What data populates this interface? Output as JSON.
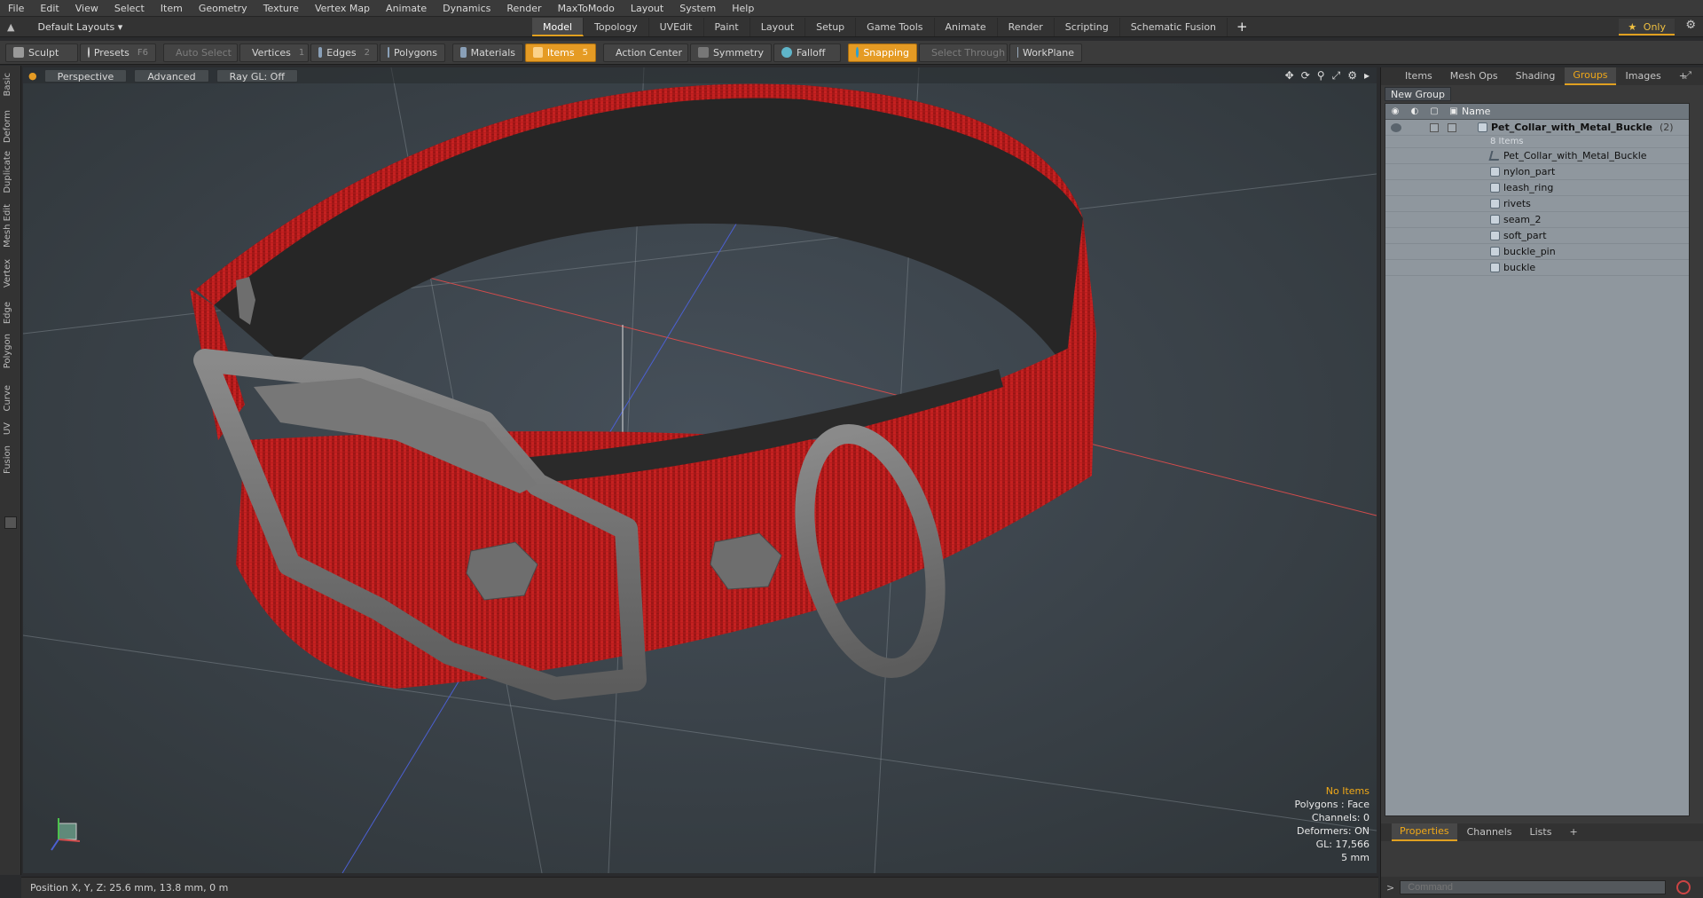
{
  "menu": [
    "File",
    "Edit",
    "View",
    "Select",
    "Item",
    "Geometry",
    "Texture",
    "Vertex Map",
    "Animate",
    "Dynamics",
    "Render",
    "MaxToModo",
    "Layout",
    "System",
    "Help"
  ],
  "layout_selector": "Default Layouts ▾",
  "top_tabs": [
    {
      "label": "Model",
      "active": true
    },
    {
      "label": "Topology",
      "active": false
    },
    {
      "label": "UVEdit",
      "active": false
    },
    {
      "label": "Paint",
      "active": false
    },
    {
      "label": "Layout",
      "active": false
    },
    {
      "label": "Setup",
      "active": false
    },
    {
      "label": "Game Tools",
      "active": false
    },
    {
      "label": "Animate",
      "active": false
    },
    {
      "label": "Render",
      "active": false
    },
    {
      "label": "Scripting",
      "active": false
    },
    {
      "label": "Schematic Fusion",
      "active": false
    }
  ],
  "add_tab": "+",
  "only_label": "Only",
  "toolbar": {
    "sculpt": "Sculpt",
    "presets": "Presets",
    "presets_key": "F6",
    "auto_select": "Auto Select",
    "vertices": "Vertices",
    "vertices_key": "1",
    "edges": "Edges",
    "edges_key": "2",
    "polygons": "Polygons",
    "materials": "Materials",
    "items": "Items",
    "items_key": "5",
    "action_center": "Action Center",
    "symmetry": "Symmetry",
    "falloff": "Falloff",
    "snapping": "Snapping",
    "select_through": "Select Through",
    "workplane": "WorkPlane"
  },
  "left_tabs": [
    "Basic",
    "Deform",
    "Duplicate",
    "Mesh Edit",
    "Vertex",
    "Edge",
    "Polygon",
    "Curve",
    "UV",
    "Fusion"
  ],
  "viewport": {
    "view": "Perspective",
    "shading": "Advanced",
    "raygl": "Ray GL: Off",
    "stats": {
      "selection": "No Items",
      "polygons": "Polygons : Face",
      "channels": "Channels: 0",
      "deformers": "Deformers: ON",
      "gl": "GL: 17,566",
      "scale": "5 mm"
    }
  },
  "status_bar": "Position X, Y, Z:   25.6 mm, 13.8 mm, 0 m",
  "right_panel": {
    "tabs": [
      {
        "label": "Items",
        "active": false
      },
      {
        "label": "Mesh Ops",
        "active": false
      },
      {
        "label": "Shading",
        "active": false
      },
      {
        "label": "Groups",
        "active": true
      },
      {
        "label": "Images",
        "active": false
      }
    ],
    "add_tab": "+",
    "new_group": "New Group",
    "column_name": "Name",
    "group": {
      "name": "Pet_Collar_with_Metal_Buckle",
      "count": "(2)",
      "sub": "8 Items"
    },
    "items": [
      {
        "name": "Pet_Collar_with_Metal_Buckle",
        "icon": "locator-icon"
      },
      {
        "name": "nylon_part",
        "icon": "mesh-icon"
      },
      {
        "name": "leash_ring",
        "icon": "mesh-icon"
      },
      {
        "name": "rivets",
        "icon": "mesh-icon"
      },
      {
        "name": "seam_2",
        "icon": "mesh-icon"
      },
      {
        "name": "soft_part",
        "icon": "mesh-icon"
      },
      {
        "name": "buckle_pin",
        "icon": "mesh-icon"
      },
      {
        "name": "buckle",
        "icon": "mesh-icon"
      }
    ],
    "bottom_tabs": [
      {
        "label": "Properties",
        "active": true
      },
      {
        "label": "Channels",
        "active": false
      },
      {
        "label": "Lists",
        "active": false
      }
    ],
    "bottom_add": "+",
    "command_prompt": ">",
    "command_placeholder": "Command"
  },
  "colors": {
    "accent": "#e59b24",
    "viewport_bg": "#3b4347",
    "collar_red": "#b81c1c",
    "buckle_grey": "#7a7a7a",
    "lining_dark": "#2a2a2a"
  }
}
